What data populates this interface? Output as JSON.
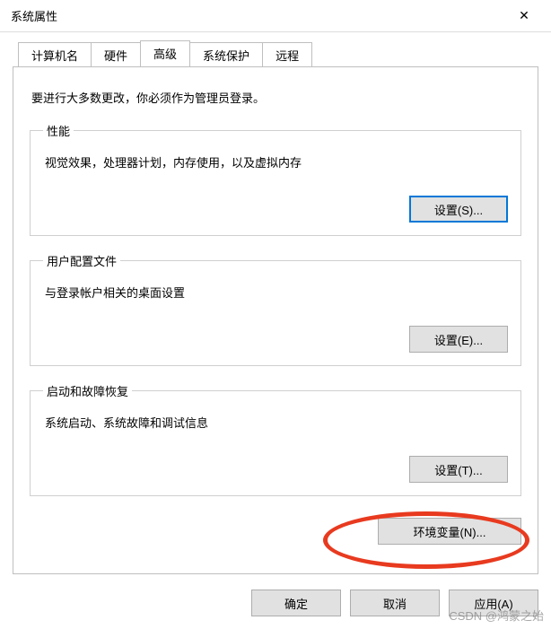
{
  "window": {
    "title": "系统属性",
    "close_icon": "✕"
  },
  "tabs": {
    "items": [
      {
        "label": "计算机名"
      },
      {
        "label": "硬件"
      },
      {
        "label": "高级"
      },
      {
        "label": "系统保护"
      },
      {
        "label": "远程"
      }
    ],
    "active_index": 2
  },
  "panel": {
    "intro": "要进行大多数更改，你必须作为管理员登录。",
    "groups": {
      "performance": {
        "legend": "性能",
        "desc": "视觉效果，处理器计划，内存使用，以及虚拟内存",
        "button": "设置(S)..."
      },
      "user_profiles": {
        "legend": "用户配置文件",
        "desc": "与登录帐户相关的桌面设置",
        "button": "设置(E)..."
      },
      "startup_recovery": {
        "legend": "启动和故障恢复",
        "desc": "系统启动、系统故障和调试信息",
        "button": "设置(T)..."
      }
    },
    "env_button": "环境变量(N)..."
  },
  "footer": {
    "ok": "确定",
    "cancel": "取消",
    "apply": "应用(A)"
  },
  "watermark": "CSDN @鸿蒙之始"
}
